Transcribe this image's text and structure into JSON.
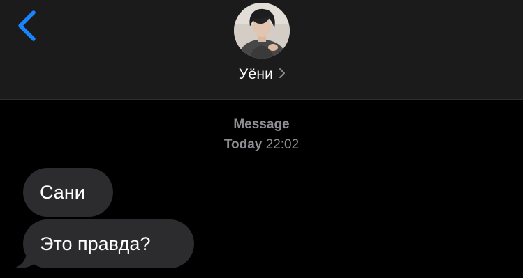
{
  "colors": {
    "header_bg": "#1b1b1b",
    "background": "#000000",
    "accent": "#1a84ff",
    "bubble_incoming": "#2c2c2e",
    "meta_text": "#8e8e93"
  },
  "header": {
    "back_icon": "chevron-left-icon",
    "contact_name": "Уёни",
    "contact_chevron_icon": "chevron-right-icon"
  },
  "thread": {
    "service_label": "Message",
    "timestamp_day": "Today",
    "timestamp_time": "22:02",
    "messages": [
      {
        "direction": "incoming",
        "text": "Сани"
      },
      {
        "direction": "incoming",
        "text": "Это правда?"
      }
    ]
  }
}
